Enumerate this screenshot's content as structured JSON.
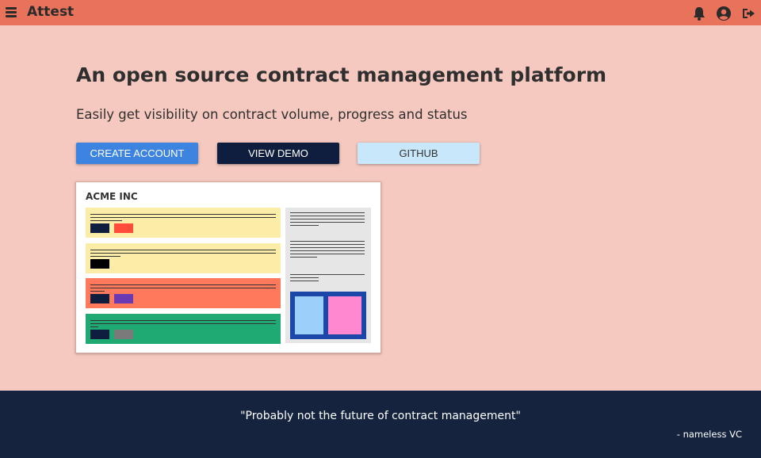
{
  "app": {
    "brand": "Attest"
  },
  "header": {
    "icons": [
      "menu-icon",
      "bell-icon",
      "user-circle-icon",
      "sign-out-icon"
    ]
  },
  "hero": {
    "title": "An open source contract management platform",
    "subtitle": "Easily get visibility on contract volume, progress and status"
  },
  "buttons": {
    "create": "CREATE ACCOUNT",
    "demo": "VIEW DEMO",
    "github": "GITHUB"
  },
  "illustration": {
    "company": "ACME INC",
    "colors": {
      "yellow": "#fbeda8",
      "orange": "#ff7a5c",
      "green": "#1faa74",
      "navy": "#0f1d3f",
      "red": "#ff4b3a",
      "purple": "#6a3ab3",
      "gray": "#7a7a7a",
      "black": "#000000",
      "panel_blue": "#1a47a8",
      "light_blue": "#9cd0fb",
      "pink": "#ff88d0"
    }
  },
  "footer": {
    "quote": "\"Probably not the future of contract management\"",
    "author": "- nameless VC"
  },
  "colors": {
    "topbar": "#e8735a",
    "background": "#f5c9bf",
    "footer": "#15233f",
    "primary": "#3d84e0"
  }
}
